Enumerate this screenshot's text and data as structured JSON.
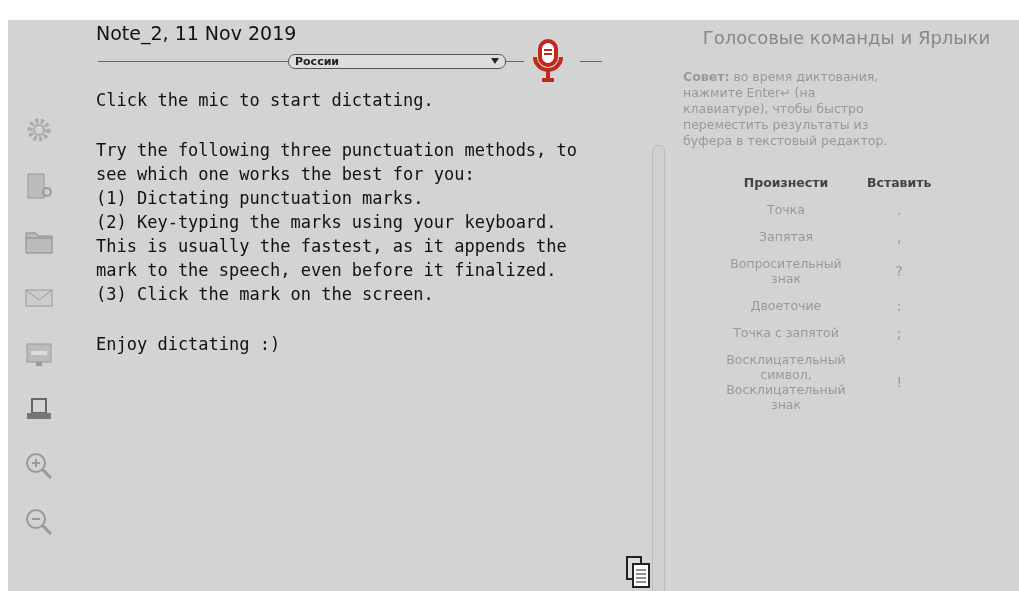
{
  "note": {
    "title": "Note_2, 11 Nov 2019",
    "language": "России"
  },
  "editor": {
    "paragraphs": [
      "Click the mic to start dictating.",
      "Try the following three punctuation methods, to see which one works the best for you:\n(1) Dictating punctuation marks.\n(2) Key-typing the marks using your keyboard. This is usually the fastest, as it appends the mark to the speech, even before it finalized.\n(3) Click the mark on the screen.",
      "Enjoy dictating :)"
    ]
  },
  "commands": {
    "title": "Голосовые команды и Ярлыки",
    "tip": "**Совет:** во время диктования, нажмите Enter↵ (на клавиатуре), чтобы быстро переместить результаты из буфера в текстовый редактор.",
    "columns": [
      "Произнести",
      "Вставить"
    ],
    "rows": [
      {
        "say": "Точка",
        "insert": "."
      },
      {
        "say": "Запятая",
        "insert": ","
      },
      {
        "say": "Вопросительный знак",
        "insert": "?"
      },
      {
        "say": "Двоеточие",
        "insert": ":"
      },
      {
        "say": "Точка с запятой",
        "insert": ";"
      },
      {
        "say": "Восклицательный символ, Восклицательный знак",
        "insert": "!"
      }
    ]
  }
}
